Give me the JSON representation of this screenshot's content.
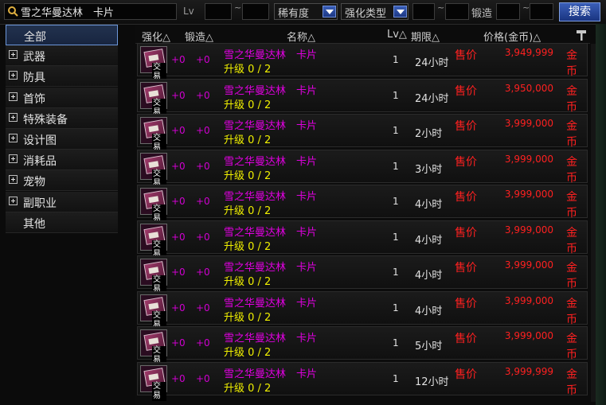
{
  "search": {
    "value": "雪之华曼达林　卡片",
    "placeholder": ""
  },
  "filters": {
    "lv_label": "Lv",
    "lv_min": "",
    "lv_max": "",
    "tilde": "~",
    "rarity": "稀有度",
    "enhance_type": "强化类型",
    "enh_min": "",
    "enh_max": "",
    "forge_label": "锻造",
    "forge_min": "",
    "forge_max": "",
    "search_button": "搜索"
  },
  "sidebar": {
    "items": [
      {
        "label": "全部",
        "expandable": false,
        "selected": true
      },
      {
        "label": "武器",
        "expandable": true
      },
      {
        "label": "防具",
        "expandable": true
      },
      {
        "label": "首饰",
        "expandable": true
      },
      {
        "label": "特殊装备",
        "expandable": true
      },
      {
        "label": "设计图",
        "expandable": true
      },
      {
        "label": "消耗品",
        "expandable": true
      },
      {
        "label": "宠物",
        "expandable": true
      },
      {
        "label": "副职业",
        "expandable": true
      },
      {
        "label": "其他",
        "expandable": false
      }
    ]
  },
  "table": {
    "headers": {
      "enhance": "强化△",
      "forge": "锻造△",
      "name": "名称△",
      "lv": "Lv△",
      "period": "期限△",
      "price": "价格(金币)△"
    },
    "rows": [
      {
        "enhance": "+0",
        "forge": "+0",
        "name": "雪之华曼达林　卡片",
        "upgrade": "升级 0 / 2",
        "lv": "1",
        "period": "24小时",
        "sell": "售价",
        "price": "3,949,999",
        "currency": "金币",
        "tag": "交易"
      },
      {
        "enhance": "+0",
        "forge": "+0",
        "name": "雪之华曼达林　卡片",
        "upgrade": "升级 0 / 2",
        "lv": "1",
        "period": "24小时",
        "sell": "售价",
        "price": "3,950,000",
        "currency": "金币",
        "tag": "交易"
      },
      {
        "enhance": "+0",
        "forge": "+0",
        "name": "雪之华曼达林　卡片",
        "upgrade": "升级 0 / 2",
        "lv": "1",
        "period": "2小时",
        "sell": "售价",
        "price": "3,999,000",
        "currency": "金币",
        "tag": "交易"
      },
      {
        "enhance": "+0",
        "forge": "+0",
        "name": "雪之华曼达林　卡片",
        "upgrade": "升级 0 / 2",
        "lv": "1",
        "period": "3小时",
        "sell": "售价",
        "price": "3,999,000",
        "currency": "金币",
        "tag": "交易"
      },
      {
        "enhance": "+0",
        "forge": "+0",
        "name": "雪之华曼达林　卡片",
        "upgrade": "升级 0 / 2",
        "lv": "1",
        "period": "4小时",
        "sell": "售价",
        "price": "3,999,000",
        "currency": "金币",
        "tag": "交易"
      },
      {
        "enhance": "+0",
        "forge": "+0",
        "name": "雪之华曼达林　卡片",
        "upgrade": "升级 0 / 2",
        "lv": "1",
        "period": "4小时",
        "sell": "售价",
        "price": "3,999,000",
        "currency": "金币",
        "tag": "交易"
      },
      {
        "enhance": "+0",
        "forge": "+0",
        "name": "雪之华曼达林　卡片",
        "upgrade": "升级 0 / 2",
        "lv": "1",
        "period": "4小时",
        "sell": "售价",
        "price": "3,999,000",
        "currency": "金币",
        "tag": "交易"
      },
      {
        "enhance": "+0",
        "forge": "+0",
        "name": "雪之华曼达林　卡片",
        "upgrade": "升级 0 / 2",
        "lv": "1",
        "period": "4小时",
        "sell": "售价",
        "price": "3,999,000",
        "currency": "金币",
        "tag": "交易"
      },
      {
        "enhance": "+0",
        "forge": "+0",
        "name": "雪之华曼达林　卡片",
        "upgrade": "升级 0 / 2",
        "lv": "1",
        "period": "5小时",
        "sell": "售价",
        "price": "3,999,000",
        "currency": "金币",
        "tag": "交易"
      },
      {
        "enhance": "+0",
        "forge": "+0",
        "name": "雪之华曼达林　卡片",
        "upgrade": "升级 0 / 2",
        "lv": "1",
        "period": "12小时",
        "sell": "售价",
        "price": "3,999,999",
        "currency": "金币",
        "tag": "交易"
      }
    ]
  },
  "colors": {
    "accent": "#2f54a8",
    "price_red": "#ff2020",
    "name_magenta": "#e000e0",
    "upgrade_yellow": "#f0f000"
  },
  "icons": {
    "search": "magnifier-icon",
    "card": "card-item-icon",
    "expand": "plus-box-icon",
    "hammer": "hammer-icon"
  }
}
